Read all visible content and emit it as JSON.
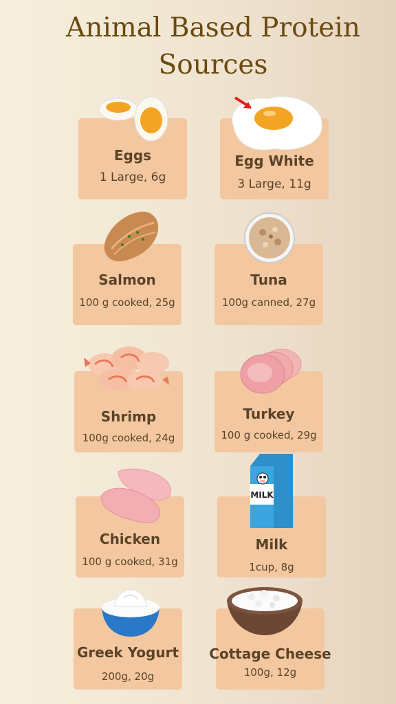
{
  "title": "Animal Based Protein Sources",
  "items": [
    {
      "name": "Eggs",
      "amount": "1 Large, 6g",
      "icon": "boiled-egg-icon"
    },
    {
      "name": "Egg White",
      "amount": "3 Large, 11g",
      "icon": "fried-egg-icon"
    },
    {
      "name": "Salmon",
      "amount": "100 g cooked, 25g",
      "icon": "salmon-fillet-icon"
    },
    {
      "name": "Tuna",
      "amount": "100g canned, 27g",
      "icon": "tuna-bowl-icon"
    },
    {
      "name": "Shrimp",
      "amount": "100g cooked, 24g",
      "icon": "shrimp-icon"
    },
    {
      "name": "Turkey",
      "amount": "100 g cooked, 29g",
      "icon": "turkey-slices-icon"
    },
    {
      "name": "Chicken",
      "amount": "100 g cooked, 31g",
      "icon": "chicken-breast-icon"
    },
    {
      "name": "Milk",
      "amount": "1cup, 8g",
      "icon": "milk-carton-icon",
      "carton_label": "MILK"
    },
    {
      "name": "Greek Yogurt",
      "amount": "200g, 20g",
      "icon": "yogurt-bowl-icon"
    },
    {
      "name": "Cottage Cheese",
      "amount": "100g, 12g",
      "icon": "cottage-cheese-bowl-icon"
    }
  ]
}
